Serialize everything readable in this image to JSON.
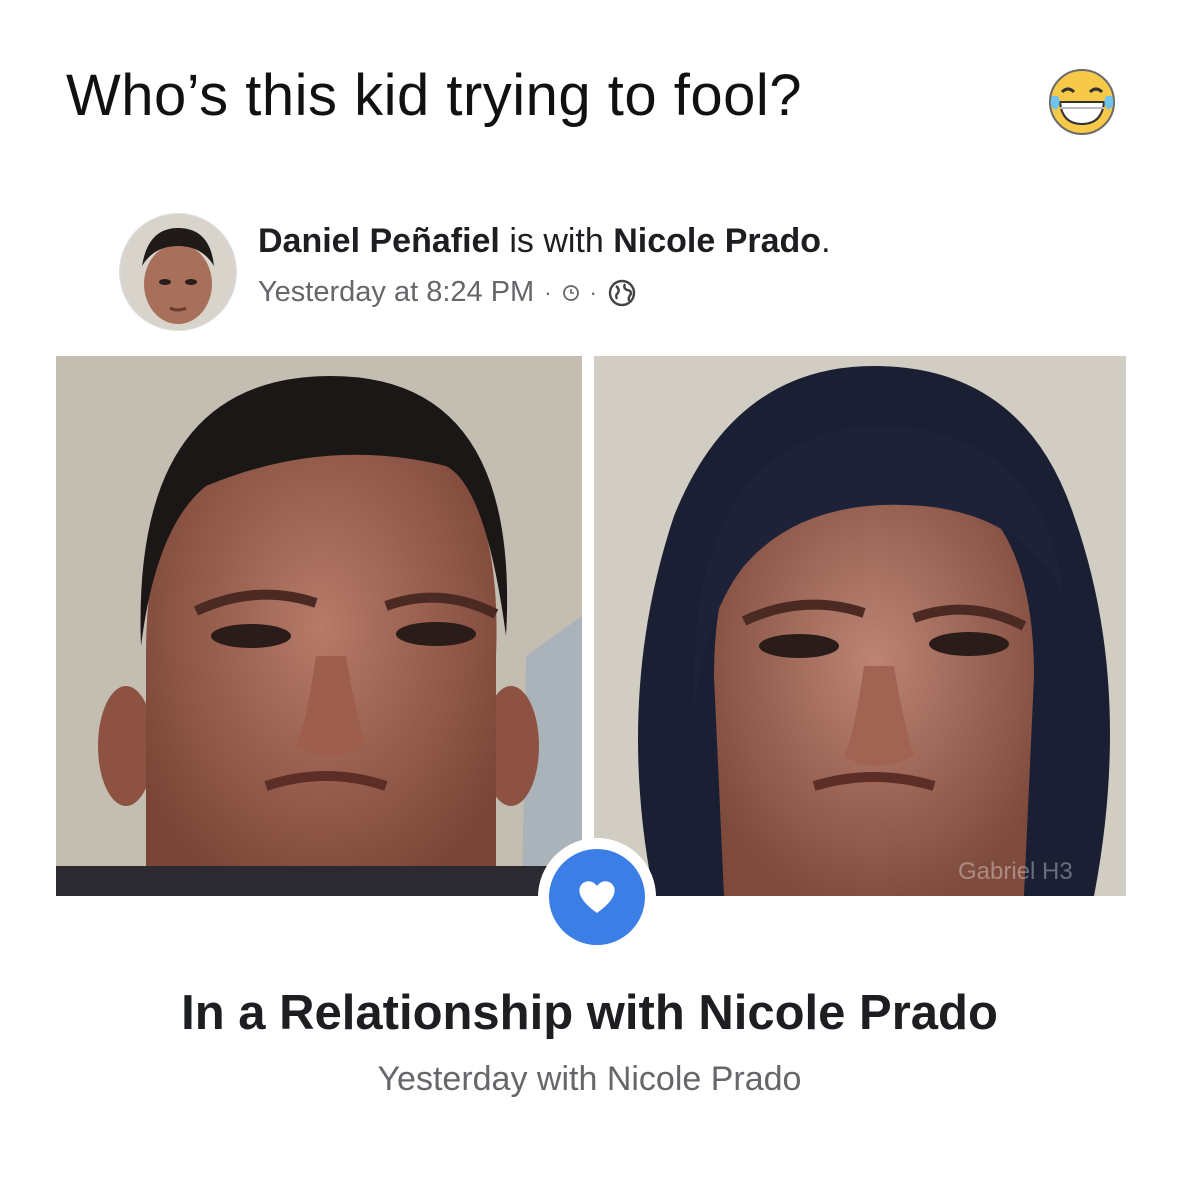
{
  "caption": {
    "text": "Who’s this kid trying to fool?",
    "emoji": "laughing-tears-icon"
  },
  "post": {
    "author": "Daniel Peñafiel",
    "connector": " is with ",
    "tagged": "Nicole Prado",
    "end": ".",
    "timestamp": "Yesterday at 8:24 PM",
    "separator": "·"
  },
  "photos": {
    "watermark": "Gabriel H3"
  },
  "relationship": {
    "title": "In a Relationship with Nicole Prado",
    "subtitle": "Yesterday with Nicole Prado",
    "accent": "#3b7ee6"
  }
}
